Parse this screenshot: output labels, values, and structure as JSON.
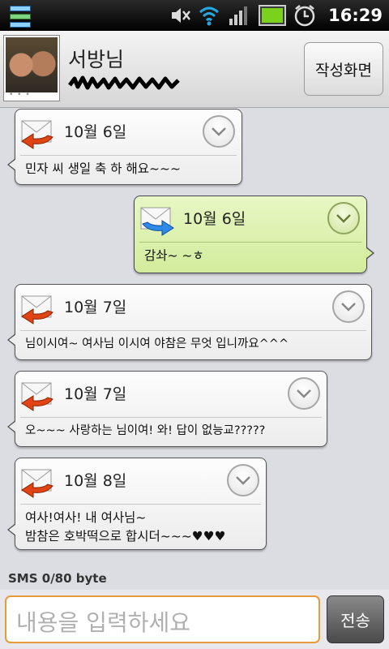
{
  "status_bar": {
    "time": "16:29",
    "icons": [
      "app-icon",
      "mute-icon",
      "wifi-icon",
      "signal-icon",
      "battery-icon",
      "alarm-icon"
    ]
  },
  "header": {
    "contact_name": "서방님",
    "compose_button": "작성화면"
  },
  "messages": [
    {
      "direction": "received",
      "date": "10월 6일",
      "body": "민자 씨 생일 축 하  해요~~~"
    },
    {
      "direction": "sent",
      "date": "10월 6일",
      "body": "감솨~ ~ㅎ"
    },
    {
      "direction": "received",
      "date": "10월 7일",
      "body": "님이시여~ 여사님 이시여  야참은 무엇  입니까요^^^"
    },
    {
      "direction": "received",
      "date": "10월 7일",
      "body": "오~~~ 사랑하는 님이여!  와!  답이 없능교?????"
    },
    {
      "direction": "received",
      "date": "10월 8일",
      "body": "여사!여사!  내 여사님~\n밤참은 호박떡으로 합시더~~~♥♥♥"
    }
  ],
  "counter": "SMS  0/80 byte",
  "input": {
    "placeholder": "내용을 입력하세요"
  },
  "send_button": "전송",
  "colors": {
    "sent_bubble": "#d8eea6",
    "received_bubble": "#f4f4f4",
    "input_border": "#e79a3a",
    "background": "#dcdde2"
  }
}
